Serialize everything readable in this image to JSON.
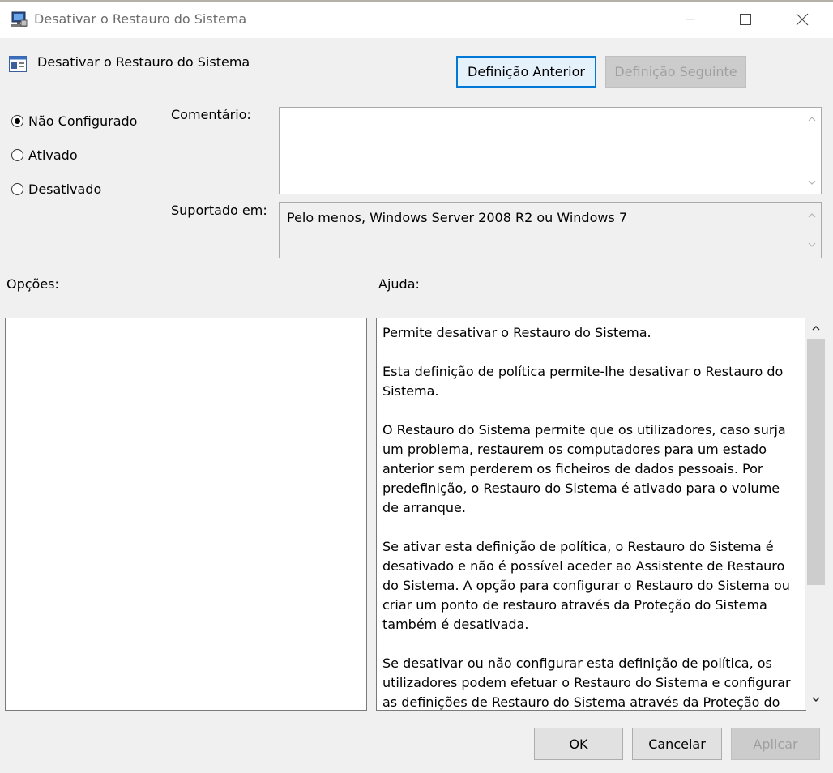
{
  "window": {
    "title": "Desativar o Restauro do Sistema",
    "icons": {
      "app": "computer-monitor-icon",
      "minimize": "minimize-icon",
      "maximize": "maximize-icon",
      "close": "close-icon"
    }
  },
  "header": {
    "setting_title": "Desativar o Restauro do Sistema",
    "setting_icon": "policy-setting-icon",
    "prev_label": "Definição Anterior",
    "next_label": "Definição Seguinte"
  },
  "state": {
    "options": [
      {
        "label": "Não Configurado",
        "checked": true
      },
      {
        "label": "Ativado",
        "checked": false
      },
      {
        "label": "Desativado",
        "checked": false
      }
    ]
  },
  "comment": {
    "label": "Comentário:",
    "value": ""
  },
  "supported": {
    "label": "Suportado em:",
    "value": "Pelo menos, Windows Server 2008 R2 ou Windows 7"
  },
  "sections": {
    "options_label": "Opções:",
    "help_label": "Ajuda:"
  },
  "help": {
    "paragraphs": [
      "Permite desativar o Restauro do Sistema.",
      "Esta definição de política permite-lhe desativar o Restauro do Sistema.",
      "O Restauro do Sistema permite que os utilizadores, caso surja um problema, restaurem os computadores para um estado anterior sem perderem os ficheiros de dados pessoais. Por predefinição, o Restauro do Sistema é ativado para o volume de arranque.",
      "Se ativar esta definição de política, o Restauro do Sistema é desativado e não é possível aceder ao Assistente de Restauro do Sistema. A opção para configurar o Restauro do Sistema ou criar um ponto de restauro através da Proteção do Sistema também é desativada.",
      "Se desativar ou não configurar esta definição de política, os utilizadores podem efetuar o Restauro do Sistema e configurar as definições de Restauro do Sistema através da Proteção do Sistema."
    ]
  },
  "footer": {
    "ok_label": "OK",
    "cancel_label": "Cancelar",
    "apply_label": "Aplicar"
  },
  "colors": {
    "accent": "#0078d7",
    "disabled_text": "#a0a0a0"
  }
}
